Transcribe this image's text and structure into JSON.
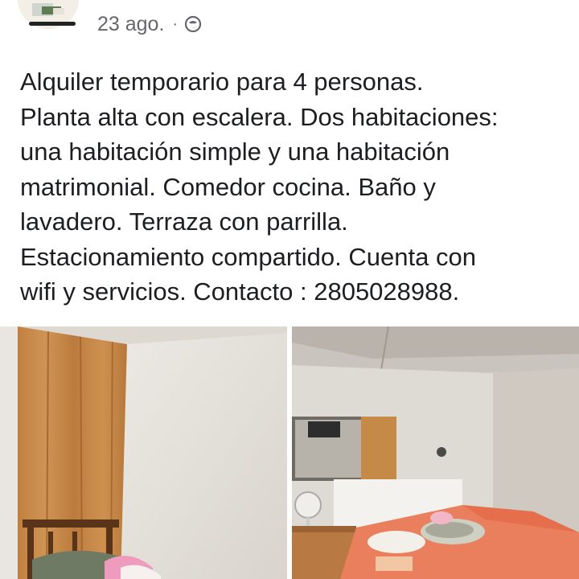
{
  "post": {
    "timestamp": "23 ago.",
    "separator": "·",
    "audience_icon": "globe-icon",
    "text": "Alquiler temporario para 4 personas.\nPlanta alta con escalera. Dos habitaciones:\nuna habitación simple y una habitación\nmatrimonial. Comedor cocina. Baño y\nlavadero. Terraza con parrilla.\nEstacionamiento compartido. Cuenta con\nwifi y servicios. Contacto : 2805028988."
  },
  "photos": [
    {
      "subject": "bedroom-wood-wall"
    },
    {
      "subject": "bedroom-double-bed"
    }
  ],
  "colors": {
    "meta_text": "#65676b",
    "body_text": "#1c1e21",
    "background": "#ffffff"
  }
}
